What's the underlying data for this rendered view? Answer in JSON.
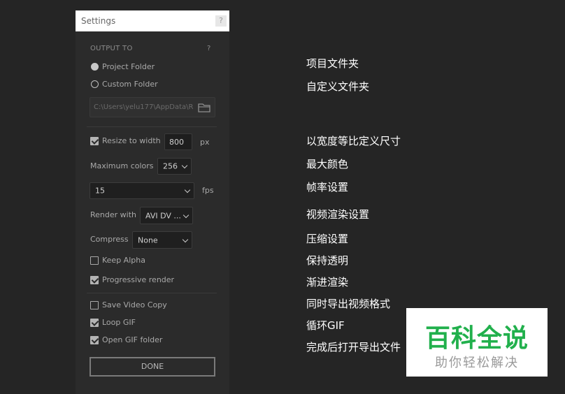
{
  "dialog": {
    "title": "Settings",
    "title_help": "?",
    "output_to": "OUTPUT TO",
    "output_help": "?",
    "options": {
      "project_folder": "Project Folder",
      "custom_folder": "Custom Folder"
    },
    "path_value": "C:\\Users\\yelu177\\AppData\\R",
    "resize_to_width_label": "Resize to width",
    "resize_to_width_value": "800",
    "px_unit": "px",
    "maximum_colors_label": "Maximum colors",
    "maximum_colors_value": "256",
    "fps_value": "15",
    "fps_unit": "fps",
    "render_with_label": "Render with",
    "render_with_value": "AVI DV ...",
    "compress_label": "Compress",
    "compress_value": "None",
    "keep_alpha": "Keep Alpha",
    "progressive_render": "Progressive render",
    "save_video_copy": "Save Video Copy",
    "loop_gif": "Loop GIF",
    "open_gif_folder": "Open GIF folder",
    "done": "DONE"
  },
  "state": {
    "project_folder_selected": true,
    "custom_folder_selected": false,
    "resize_checked": true,
    "keep_alpha_checked": false,
    "progressive_render_checked": true,
    "save_video_copy_checked": false,
    "loop_gif_checked": true,
    "open_gif_folder_checked": true
  },
  "notes": {
    "project_folder": "项目文件夹",
    "custom_folder": "自定义文件夹",
    "resize": "以宽度等比定义尺寸",
    "max_colors": "最大颜色",
    "fps": "帧率设置",
    "render": "视频渲染设置",
    "compress": "压缩设置",
    "keep_alpha": "保持透明",
    "progressive": "渐进渲染",
    "save_video": "同时导出视频格式",
    "loop_gif": "循环GIF",
    "open_folder": "完成后打开导出文件"
  },
  "watermark": {
    "main": "百科全说",
    "sub": "助你轻松解决"
  },
  "icons": {
    "folder": "folder-icon",
    "help": "help-icon"
  },
  "colors": {
    "background": "#252525",
    "panel": "#2b2b2b",
    "watermark_green": "#21b04c"
  }
}
